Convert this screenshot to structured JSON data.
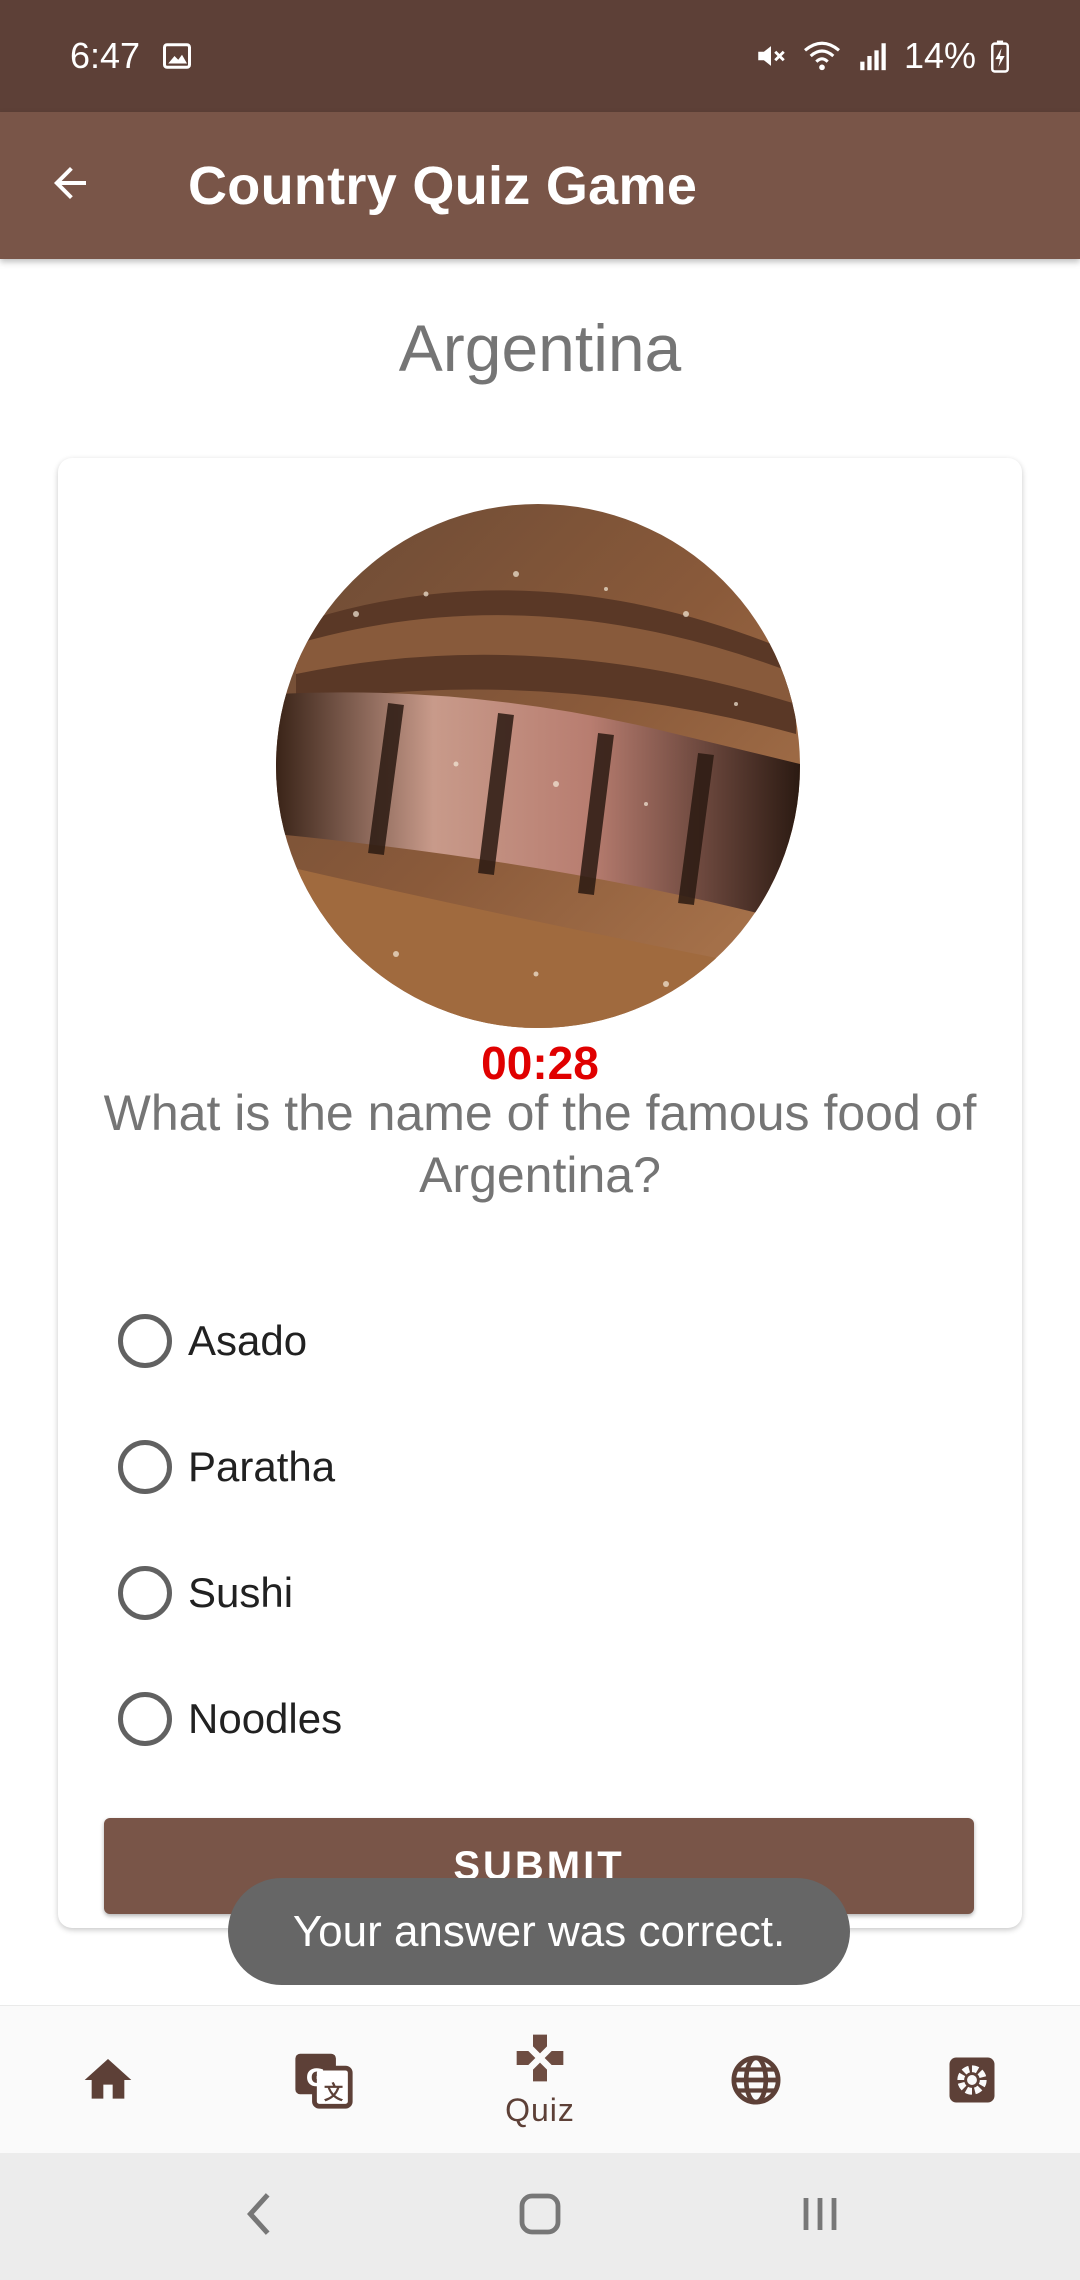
{
  "status_bar": {
    "time": "6:47",
    "battery": "14%",
    "icons": [
      "image-icon",
      "mute-icon",
      "wifi-icon",
      "signal-icon",
      "battery-charging-icon"
    ]
  },
  "app_bar": {
    "title": "Country Quiz Game",
    "back_icon": "arrow-left-icon"
  },
  "country": "Argentina",
  "quiz": {
    "timer": "00:28",
    "question": "What is the name of the famous food of Argentina?",
    "options": [
      "Asado",
      "Paratha",
      "Sushi",
      "Noodles"
    ],
    "submit_label": "SUBMIT"
  },
  "toast": "Your answer was correct.",
  "bottom_nav": {
    "items": [
      {
        "icon": "home-icon",
        "label": ""
      },
      {
        "icon": "translate-icon",
        "label": ""
      },
      {
        "icon": "quiz-icon",
        "label": "Quiz"
      },
      {
        "icon": "globe-icon",
        "label": ""
      },
      {
        "icon": "settings-icon",
        "label": ""
      }
    ],
    "active": "Quiz"
  },
  "colors": {
    "status_bar": "#5d4037",
    "app_bar": "#795548",
    "timer": "#e00000",
    "toast": "#666666"
  }
}
